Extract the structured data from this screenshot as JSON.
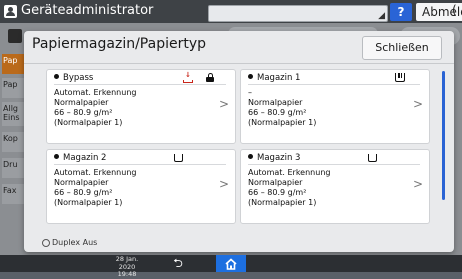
{
  "header": {
    "admin_label": "Geräteadministrator",
    "help_label": "?",
    "logout_label": "Abmelden"
  },
  "background_tabs": [
    "Pap",
    "Pap",
    "Allg Eins",
    "Kop",
    "Dru",
    "Fax"
  ],
  "modal": {
    "title": "Papiermagazin/Papiertyp",
    "close_label": "Schließen",
    "trays": [
      {
        "name": "Bypass",
        "line1": "Automat. Erkennung",
        "line2": "Normalpapier",
        "line3": "66 – 80.9 g/m²",
        "line4": "(Normalpapier 1)"
      },
      {
        "name": "Magazin 1",
        "line1": "–",
        "line2": "Normalpapier",
        "line3": "66 – 80.9 g/m²",
        "line4": "(Normalpapier 1)"
      },
      {
        "name": "Magazin 2",
        "line1": "Automat. Erkennung",
        "line2": "Normalpapier",
        "line3": "66 – 80.9 g/m²",
        "line4": "(Normalpapier 1)"
      },
      {
        "name": "Magazin 3",
        "line1": "Automat. Erkennung",
        "line2": "Normalpapier",
        "line3": "66 – 80.9 g/m²",
        "line4": "(Normalpapier 1)"
      }
    ],
    "duplex_label": "Duplex Aus"
  },
  "footer": {
    "date": "28 Jan. 2020",
    "time": "19:48"
  },
  "colors": {
    "accent_blue": "#2a63d4",
    "active_tab_orange": "#ba6a1b",
    "bypass_red": "#c9261b"
  }
}
